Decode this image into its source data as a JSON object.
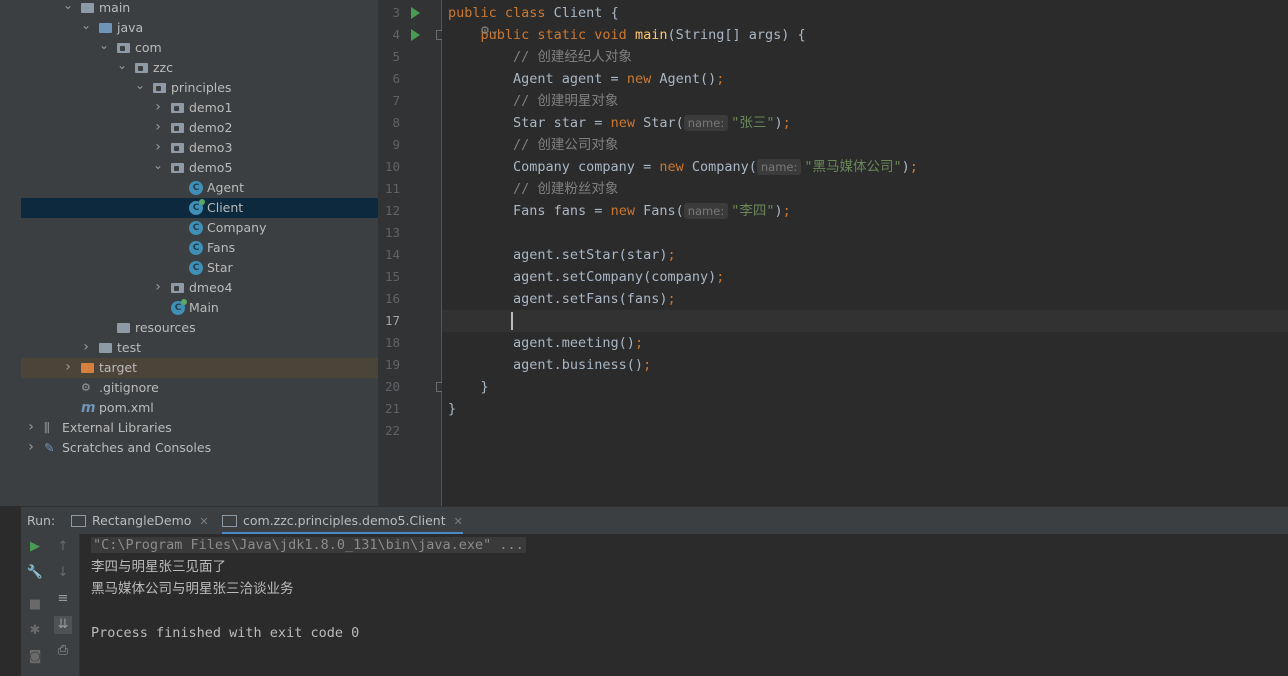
{
  "project_tree": [
    {
      "label": "main",
      "kind": "folder",
      "depth": 0,
      "expanded": true
    },
    {
      "label": "java",
      "kind": "folder-blue",
      "depth": 1,
      "expanded": true
    },
    {
      "label": "com",
      "kind": "package",
      "depth": 2,
      "expanded": true
    },
    {
      "label": "zzc",
      "kind": "package",
      "depth": 3,
      "expanded": true
    },
    {
      "label": "principles",
      "kind": "package",
      "depth": 4,
      "expanded": true
    },
    {
      "label": "demo1",
      "kind": "package",
      "depth": 5,
      "expanded": false
    },
    {
      "label": "demo2",
      "kind": "package",
      "depth": 5,
      "expanded": false
    },
    {
      "label": "demo3",
      "kind": "package",
      "depth": 5,
      "expanded": false
    },
    {
      "label": "demo5",
      "kind": "package",
      "depth": 5,
      "expanded": true
    },
    {
      "label": "Agent",
      "kind": "class",
      "depth": 6
    },
    {
      "label": "Client",
      "kind": "class-run",
      "depth": 6,
      "selected": true
    },
    {
      "label": "Company",
      "kind": "class",
      "depth": 6
    },
    {
      "label": "Fans",
      "kind": "class",
      "depth": 6
    },
    {
      "label": "Star",
      "kind": "class",
      "depth": 6
    },
    {
      "label": "dmeo4",
      "kind": "package",
      "depth": 5,
      "expanded": false
    },
    {
      "label": "Main",
      "kind": "class-run",
      "depth": 5
    },
    {
      "label": "resources",
      "kind": "resources",
      "depth": 2
    },
    {
      "label": "test",
      "kind": "folder",
      "depth": 1,
      "expanded": false
    },
    {
      "label": "target",
      "kind": "folder-orange",
      "depth": 0,
      "expanded": false,
      "highlight": true
    },
    {
      "label": ".gitignore",
      "kind": "file",
      "depth": 0
    },
    {
      "label": "pom.xml",
      "kind": "maven",
      "depth": 0
    },
    {
      "label": "External Libraries",
      "kind": "libraries",
      "depth": -1,
      "expanded": false
    },
    {
      "label": "Scratches and Consoles",
      "kind": "scratches",
      "depth": -1,
      "expanded": false
    }
  ],
  "editor": {
    "line_numbers": [
      "3",
      "4",
      "5",
      "6",
      "7",
      "8",
      "9",
      "10",
      "11",
      "12",
      "13",
      "14",
      "15",
      "16",
      "17",
      "18",
      "19",
      "20",
      "21",
      "22"
    ],
    "current_line": "17",
    "lines": [
      [
        {
          "t": "public class ",
          "c": "kw"
        },
        {
          "t": "Client",
          "c": ""
        },
        {
          "t": " {",
          "c": ""
        }
      ],
      [
        {
          "t": "    ",
          "c": ""
        },
        {
          "t": "public static void ",
          "c": "kw"
        },
        {
          "t": "main",
          "c": "fn"
        },
        {
          "t": "(String[] args) {",
          "c": ""
        }
      ],
      [
        {
          "t": "        // 创建经纪人对象",
          "c": "cm"
        }
      ],
      [
        {
          "t": "        Agent agent = ",
          "c": ""
        },
        {
          "t": "new ",
          "c": "kw"
        },
        {
          "t": "Agent()",
          "c": ""
        },
        {
          "t": ";",
          "c": "kw"
        }
      ],
      [
        {
          "t": "        // 创建明星对象",
          "c": "cm"
        }
      ],
      [
        {
          "t": "        Star star = ",
          "c": ""
        },
        {
          "t": "new ",
          "c": "kw"
        },
        {
          "t": "Star(",
          "c": ""
        },
        {
          "t": "name:",
          "c": "hint"
        },
        {
          "t": "\"张三\"",
          "c": "str"
        },
        {
          "t": ")",
          "c": ""
        },
        {
          "t": ";",
          "c": "kw"
        }
      ],
      [
        {
          "t": "        // 创建公司对象",
          "c": "cm"
        }
      ],
      [
        {
          "t": "        Company company = ",
          "c": ""
        },
        {
          "t": "new ",
          "c": "kw"
        },
        {
          "t": "Company(",
          "c": ""
        },
        {
          "t": "name:",
          "c": "hint"
        },
        {
          "t": "\"黑马媒体公司\"",
          "c": "str"
        },
        {
          "t": ")",
          "c": ""
        },
        {
          "t": ";",
          "c": "kw"
        }
      ],
      [
        {
          "t": "        // 创建粉丝对象",
          "c": "cm"
        }
      ],
      [
        {
          "t": "        Fans fans = ",
          "c": ""
        },
        {
          "t": "new ",
          "c": "kw"
        },
        {
          "t": "Fans(",
          "c": ""
        },
        {
          "t": "name:",
          "c": "hint"
        },
        {
          "t": "\"李四\"",
          "c": "str"
        },
        {
          "t": ")",
          "c": ""
        },
        {
          "t": ";",
          "c": "kw"
        }
      ],
      [],
      [
        {
          "t": "        agent.setStar(star)",
          "c": ""
        },
        {
          "t": ";",
          "c": "kw"
        }
      ],
      [
        {
          "t": "        agent.setCompany(company)",
          "c": ""
        },
        {
          "t": ";",
          "c": "kw"
        }
      ],
      [
        {
          "t": "        agent.setFans(fans)",
          "c": ""
        },
        {
          "t": ";",
          "c": "kw"
        }
      ],
      [],
      [
        {
          "t": "        agent.meeting()",
          "c": ""
        },
        {
          "t": ";",
          "c": "kw"
        }
      ],
      [
        {
          "t": "        agent.business()",
          "c": ""
        },
        {
          "t": ";",
          "c": "kw"
        }
      ],
      [
        {
          "t": "    }",
          "c": ""
        }
      ],
      [
        {
          "t": "}",
          "c": ""
        }
      ],
      []
    ]
  },
  "run_panel": {
    "label": "Run:",
    "tabs": [
      {
        "label": "RectangleDemo",
        "active": false
      },
      {
        "label": "com.zzc.principles.demo5.Client",
        "active": true
      }
    ],
    "console_lines": [
      "\"C:\\Program Files\\Java\\jdk1.8.0_131\\bin\\java.exe\" ...",
      "李四与明星张三见面了",
      "黑马媒体公司与明星张三洽谈业务",
      "",
      "Process finished with exit code 0"
    ]
  },
  "colors": {
    "keyword": "#cc7832",
    "function": "#ffc66d",
    "comment": "#808080",
    "string": "#6a8759",
    "text": "#a9b7c6",
    "selection": "#0d293e",
    "run_green": "#499c54"
  }
}
